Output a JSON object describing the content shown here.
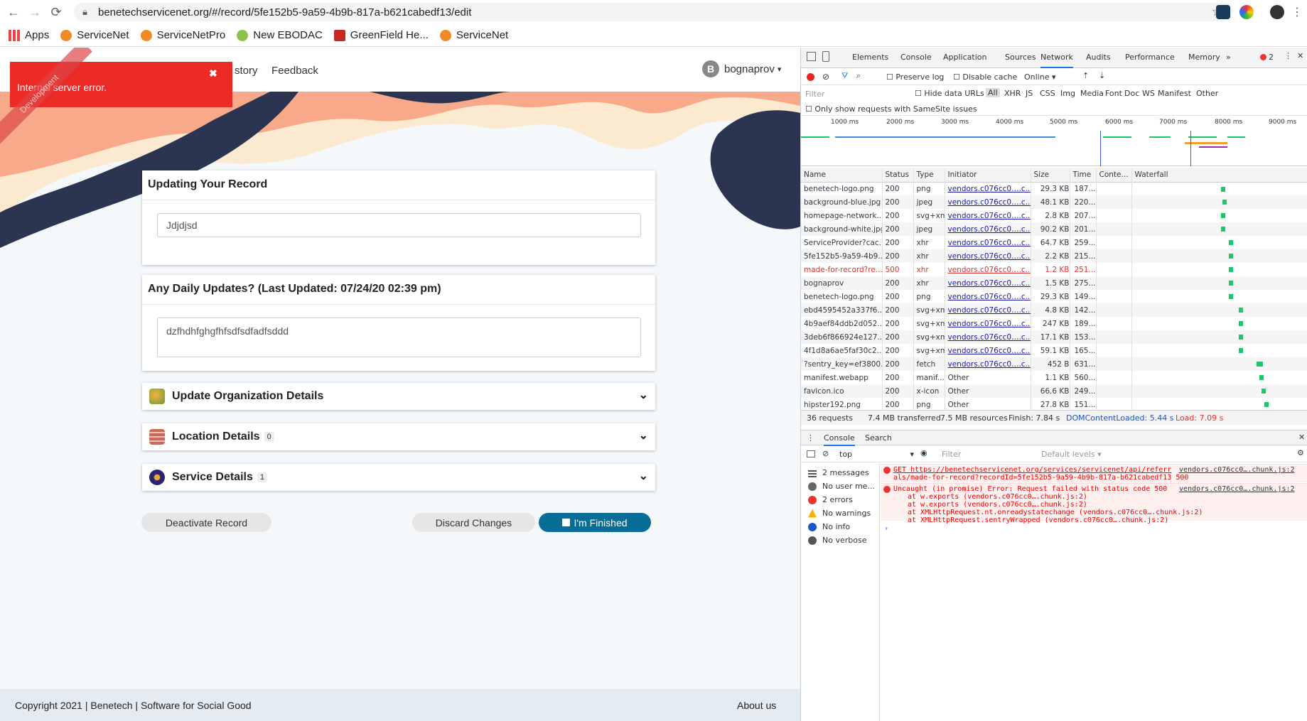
{
  "browser": {
    "url": "benetechservicenet.org/#/record/5fe152b5-9a59-4b9b-817a-b621cabedf13/edit",
    "bookmarks": [
      "Apps",
      "ServiceNet",
      "ServiceNetPro",
      "New EBODAC",
      "GreenField He...",
      "ServiceNet"
    ]
  },
  "app": {
    "nav_history": "story",
    "nav_feedback": "Feedback",
    "user_initial": "B",
    "user_name": "bognaprov",
    "user_caret": "▾",
    "toast": "Internal server error.",
    "toast_close": "✖",
    "ribbon": "Development",
    "record_title": "Updating Your Record",
    "record_name": "Jdjdjsd",
    "daily_title": "Any Daily Updates? (Last Updated: 07/24/20 02:39 pm)",
    "daily_text": "dzfhdhfghgfhfsdfsdfadfsddd",
    "org_title": "Update Organization Details",
    "location_title": "Location Details",
    "location_count": "0",
    "service_title": "Service Details",
    "service_count": "1",
    "deactivate": "Deactivate Record",
    "discard": "Discard Changes",
    "finished": "I'm Finished",
    "copyright": "Copyright 2021 | Benetech | Software for Social Good",
    "about": "About us"
  },
  "devtools": {
    "tabs": [
      "Elements",
      "Console",
      "Application",
      "Sources",
      "Network",
      "Audits",
      "Performance",
      "Memory",
      "»"
    ],
    "error_count": "2",
    "preserve": "Preserve log",
    "disable_cache": "Disable cache",
    "throttle": "Online ▾",
    "filter_placeholder": "Filter",
    "hide_data": "Hide data URLs",
    "types": [
      "All",
      "XHR",
      "JS",
      "CSS",
      "Img",
      "Media",
      "Font",
      "Doc",
      "WS",
      "Manifest",
      "Other"
    ],
    "samesite": "Only show requests with SameSite issues",
    "ticks": [
      "1000 ms",
      "2000 ms",
      "3000 ms",
      "4000 ms",
      "5000 ms",
      "6000 ms",
      "7000 ms",
      "8000 ms",
      "9000 ms"
    ],
    "columns": [
      "Name",
      "Status",
      "Type",
      "Initiator",
      "Size",
      "Time",
      "Conte...",
      "Waterfall"
    ],
    "rows": [
      [
        "benetech-logo.png",
        "200",
        "png",
        "vendors.c076cc0….c...",
        "29.3 KB",
        "187..."
      ],
      [
        "background-blue.jpg",
        "200",
        "jpeg",
        "vendors.c076cc0….c...",
        "48.1 KB",
        "220..."
      ],
      [
        "homepage-network....",
        "200",
        "svg+xml",
        "vendors.c076cc0….c...",
        "2.8 KB",
        "207..."
      ],
      [
        "background-white.jpg",
        "200",
        "jpeg",
        "vendors.c076cc0….c...",
        "90.2 KB",
        "201..."
      ],
      [
        "ServiceProvider?cac...",
        "200",
        "xhr",
        "vendors.c076cc0….c...",
        "64.7 KB",
        "259..."
      ],
      [
        "5fe152b5-9a59-4b9...",
        "200",
        "xhr",
        "vendors.c076cc0….c...",
        "2.2 KB",
        "215..."
      ],
      [
        "made-for-record?re...",
        "500",
        "xhr",
        "vendors.c076cc0….c...",
        "1.2 KB",
        "251..."
      ],
      [
        "bognaprov",
        "200",
        "xhr",
        "vendors.c076cc0….c...",
        "1.5 KB",
        "275..."
      ],
      [
        "benetech-logo.png",
        "200",
        "png",
        "vendors.c076cc0….c...",
        "29.3 KB",
        "149..."
      ],
      [
        "ebd4595452a337f6...",
        "200",
        "svg+xml",
        "vendors.c076cc0….c...",
        "4.8 KB",
        "142..."
      ],
      [
        "4b9aef84ddb2d052...",
        "200",
        "svg+xml",
        "vendors.c076cc0….c...",
        "247 KB",
        "189..."
      ],
      [
        "3deb6f866924e127...",
        "200",
        "svg+xml",
        "vendors.c076cc0….c...",
        "17.1 KB",
        "153..."
      ],
      [
        "4f1d8a6ae5faf30c2...",
        "200",
        "svg+xml",
        "vendors.c076cc0….c...",
        "59.1 KB",
        "165..."
      ],
      [
        "?sentry_key=ef3800...",
        "200",
        "fetch",
        "vendors.c076cc0….c...",
        "452 B",
        "631..."
      ],
      [
        "manifest.webapp",
        "200",
        "manif...",
        "Other",
        "1.1 KB",
        "560..."
      ],
      [
        "favicon.ico",
        "200",
        "x-icon",
        "Other",
        "66.6 KB",
        "249..."
      ],
      [
        "hipster192.png",
        "200",
        "png",
        "Other",
        "27.8 KB",
        "151..."
      ]
    ],
    "summary": [
      "36 requests",
      "7.4 MB transferred",
      "7.5 MB resources",
      "Finish: 7.84 s",
      "DOMContentLoaded: 5.44 s",
      "Load: 7.09 s"
    ],
    "drawer_tabs": [
      "Console",
      "Search"
    ],
    "context": "top",
    "console_filter": "Filter",
    "levels": "Default levels ▾",
    "sidebar": [
      "2 messages",
      "No user me...",
      "2 errors",
      "No warnings",
      "No info",
      "No verbose"
    ],
    "err1_a": "GET https://benetechservicenet.org/services/servicenet/api/referr",
    "err1_b": "als/made-for-record?recordId=5fe152b5-9a59-4b9b-817a-b621cabedf13 500",
    "err1_src": "vendors.c076cc0….chunk.js:2",
    "err2": "Uncaught (in promise) Error: Request failed with status code 500",
    "err2_src": "vendors.c076cc0….chunk.js:2",
    "stack": [
      "at w.exports (vendors.c076cc0….chunk.js:2)",
      "at w.exports (vendors.c076cc0….chunk.js:2)",
      "at XMLHttpRequest.nt.onreadystatechange (vendors.c076cc0….chunk.js:2)",
      "at XMLHttpRequest.sentryWrapped (vendors.c076cc0….chunk.js:2)"
    ]
  }
}
